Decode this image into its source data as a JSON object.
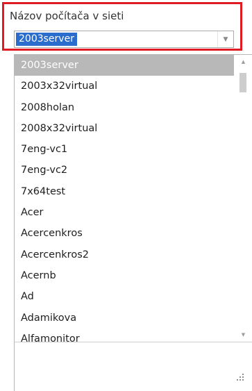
{
  "field": {
    "label": "Názov počítača v sieti",
    "selected_value": "2003server"
  },
  "dropdown": {
    "items": [
      "2003server",
      "2003x32virtual",
      "2008holan",
      "2008x32virtual",
      "7eng-vc1",
      "7eng-vc2",
      "7x64test",
      "Acer",
      "Acercenkros",
      "Acercenkros2",
      "Acernb",
      "Ad",
      "Adamikova",
      "Alfamonitor"
    ],
    "selected_index": 0
  },
  "icons": {
    "combo_arrow": "chevron-down-icon",
    "scroll_up": "scroll-up-icon",
    "scroll_down": "scroll-down-icon",
    "resize": "resize-grip-icon"
  },
  "colors": {
    "highlight_border": "#e01b24",
    "selection_blue": "#2b6dcc",
    "list_selection_gray": "#b8b8b8"
  }
}
